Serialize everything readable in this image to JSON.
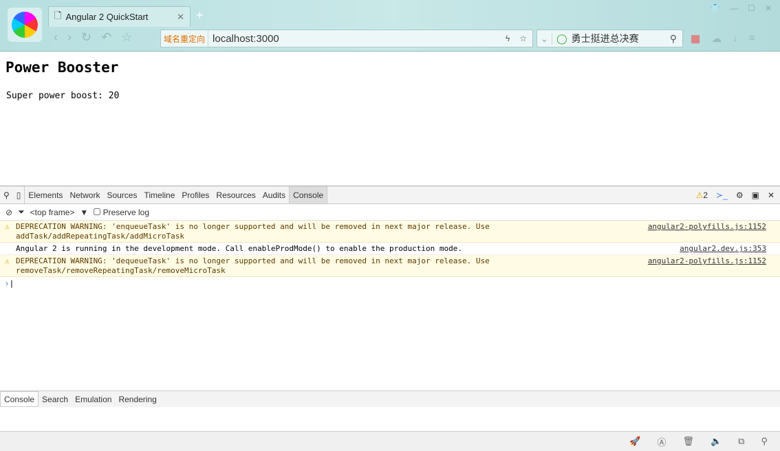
{
  "browser": {
    "tab_title": "Angular 2 QuickStart",
    "redirect_label": "域名重定向",
    "url": "localhost:3000",
    "search_text": "勇士挺进总决赛"
  },
  "page": {
    "title": "Power Booster",
    "text": "Super power boost: 20"
  },
  "devtools": {
    "tabs": [
      "Elements",
      "Network",
      "Sources",
      "Timeline",
      "Profiles",
      "Resources",
      "Audits",
      "Console"
    ],
    "warning_count": "2",
    "frame": "<top frame>",
    "preserve_log": "Preserve log",
    "messages": [
      {
        "type": "warning",
        "text": "DEPRECATION WARNING: 'enqueueTask' is no longer supported and will be removed in next major release. Use addTask/addRepeatingTask/addMicroTask",
        "source": "angular2-polyfills.js:1152"
      },
      {
        "type": "log",
        "text": "Angular 2 is running in the development mode. Call enableProdMode() to enable the production mode.",
        "source": "angular2.dev.js:353"
      },
      {
        "type": "warning",
        "text": "DEPRECATION WARNING: 'dequeueTask' is no longer supported and will be removed in next major release. Use removeTask/removeRepeatingTask/removeMicroTask",
        "source": "angular2-polyfills.js:1152"
      }
    ],
    "drawer_tabs": [
      "Console",
      "Search",
      "Emulation",
      "Rendering"
    ]
  }
}
